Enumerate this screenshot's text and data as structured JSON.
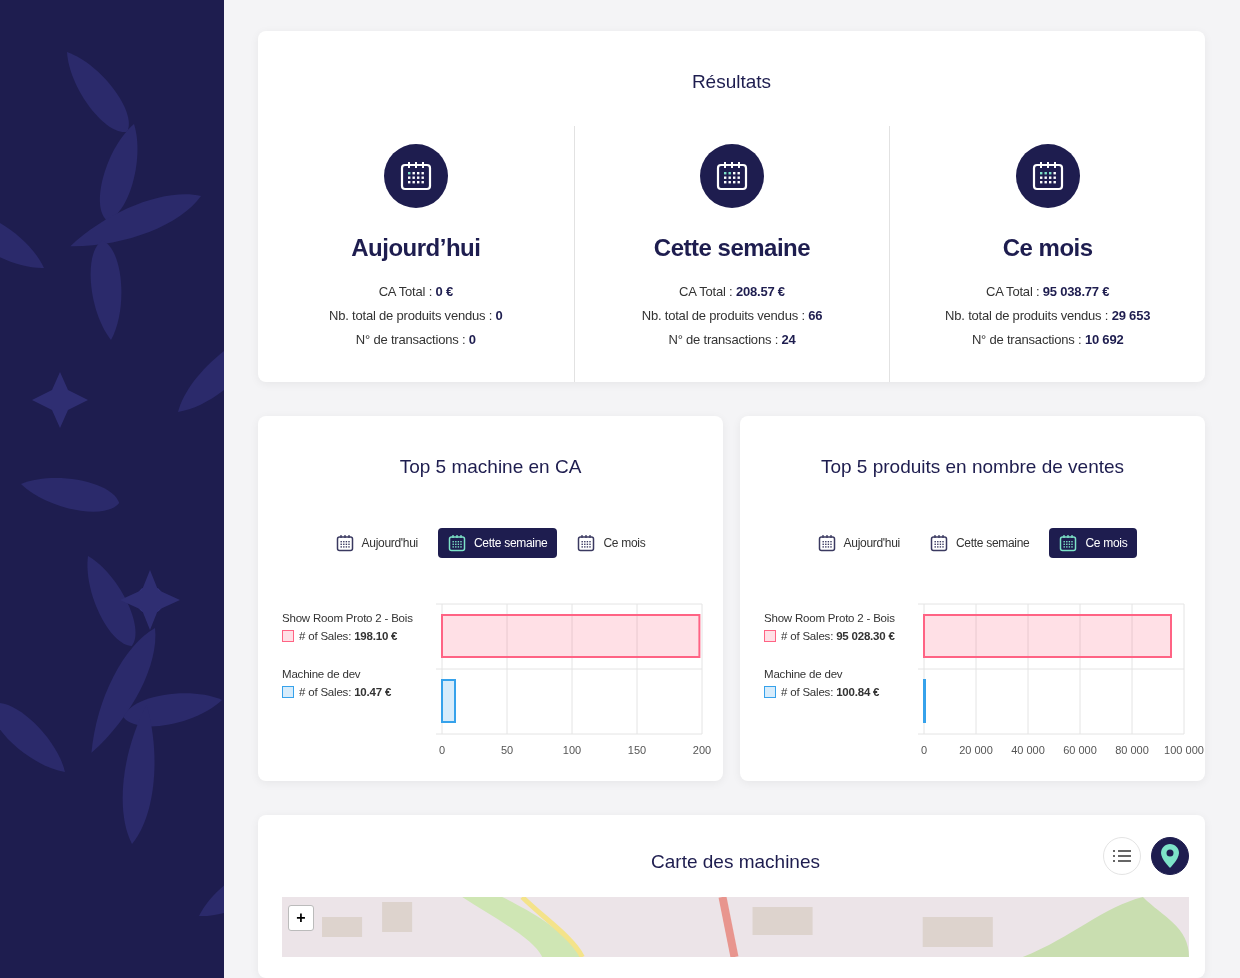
{
  "results": {
    "title": "Résultats",
    "periods": [
      {
        "title": "Aujourd’hui",
        "lines": [
          "CA Total : **0 €**",
          "Nb. total de produits vendus : **0**",
          "N° de transactions : **0**"
        ]
      },
      {
        "title": "Cette semaine",
        "lines": [
          "CA Total : **208.57 €**",
          "Nb. total de produits vendus : **66**",
          "N° de transactions : **24**"
        ]
      },
      {
        "title": "Ce mois",
        "lines": [
          "CA Total : **95 038.77 €**",
          "Nb. total de produits vendus : **29 653**",
          "N° de transactions : **10 692**"
        ]
      }
    ]
  },
  "charts": [
    {
      "title": "Top 5 machine en CA",
      "filters": [
        {
          "label": "Aujourd'hui",
          "selected": false
        },
        {
          "label": "Cette semaine",
          "selected": true
        },
        {
          "label": "Ce mois",
          "selected": false
        }
      ],
      "legend": [
        {
          "name": "Show Room Proto 2 - Bois",
          "value": "# of Sales: **198.10 €**",
          "color": "#ff6384"
        },
        {
          "name": "Machine de dev",
          "value": "# of Sales: **10.47 €**",
          "color": "#36a2eb"
        }
      ],
      "chart_data": {
        "type": "bar",
        "orientation": "horizontal",
        "grid": true,
        "values": [
          198,
          10
        ],
        "xlim": [
          0,
          200
        ],
        "xticks": [
          0,
          50,
          100,
          150,
          200
        ]
      }
    },
    {
      "title": "Top 5 produits en nombre de ventes",
      "filters": [
        {
          "label": "Aujourd'hui",
          "selected": false
        },
        {
          "label": "Cette semaine",
          "selected": false
        },
        {
          "label": "Ce mois",
          "selected": true
        }
      ],
      "legend": [
        {
          "name": "Show Room Proto 2 - Bois",
          "value": "# of Sales: **95 028.30 €**",
          "color": "#ff6384"
        },
        {
          "name": "Machine de dev",
          "value": "# of Sales: **100.84 €**",
          "color": "#36a2eb"
        }
      ],
      "chart_data": {
        "type": "bar",
        "orientation": "horizontal",
        "grid": true,
        "values": [
          95000,
          100
        ],
        "xlim": [
          0,
          100000
        ],
        "xticks": [
          {
            "value": 0,
            "label": "0"
          },
          {
            "value": 20000,
            "label": "20 000"
          },
          {
            "value": 40000,
            "label": "40 000"
          },
          {
            "value": 60000,
            "label": "60 000"
          },
          {
            "value": 80000,
            "label": "80 000"
          },
          {
            "value": 100000,
            "label": "100 000"
          }
        ]
      }
    }
  ],
  "map": {
    "title": "Carte des machines",
    "views": [
      {
        "kind": "list",
        "selected": false
      },
      {
        "kind": "map",
        "selected": true
      }
    ],
    "zoom_in": "+"
  }
}
